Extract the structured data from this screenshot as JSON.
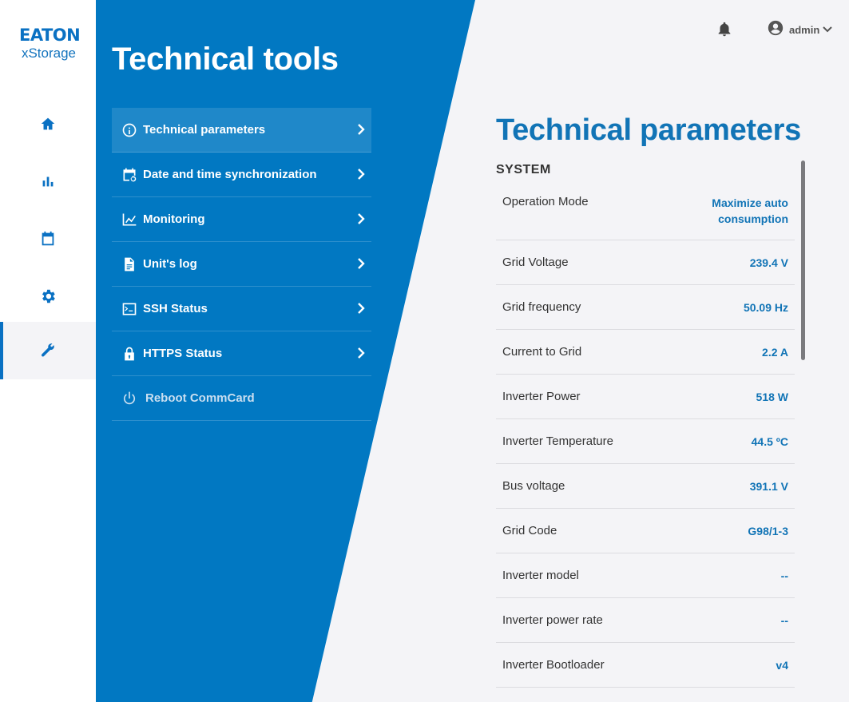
{
  "brand": {
    "name": "EATON",
    "product": "xStorage"
  },
  "rail": {
    "items": [
      {
        "icon": "home-icon"
      },
      {
        "icon": "bar-chart-icon"
      },
      {
        "icon": "calendar-icon"
      },
      {
        "icon": "gear-icon"
      },
      {
        "icon": "wrench-icon",
        "active": true
      }
    ]
  },
  "tools": {
    "title": "Technical tools",
    "menu": [
      {
        "label": "Technical parameters",
        "icon": "info-icon",
        "active": true
      },
      {
        "label": "Date and time synchronization",
        "icon": "calendar-sync-icon"
      },
      {
        "label": "Monitoring",
        "icon": "line-chart-icon"
      },
      {
        "label": "Unit's log",
        "icon": "document-icon"
      },
      {
        "label": "SSH Status",
        "icon": "terminal-icon"
      },
      {
        "label": "HTTPS Status",
        "icon": "lock-icon"
      },
      {
        "label": "Reboot CommCard",
        "icon": "power-icon"
      }
    ]
  },
  "header": {
    "user": "admin"
  },
  "main": {
    "title": "Technical parameters",
    "section": "SYSTEM",
    "rows": [
      {
        "key": "Operation Mode",
        "value": "Maximize auto consumption"
      },
      {
        "key": "Grid Voltage",
        "value": "239.4 V"
      },
      {
        "key": "Grid frequency",
        "value": "50.09 Hz"
      },
      {
        "key": "Current to Grid",
        "value": "2.2 A"
      },
      {
        "key": "Inverter Power",
        "value": "518 W"
      },
      {
        "key": "Inverter Temperature",
        "value": "44.5 ºC"
      },
      {
        "key": "Bus voltage",
        "value": "391.1 V"
      },
      {
        "key": "Grid Code",
        "value": "G98/1-3"
      },
      {
        "key": "Inverter model",
        "value": "--"
      },
      {
        "key": "Inverter power rate",
        "value": "--"
      },
      {
        "key": "Inverter Bootloader",
        "value": "v4"
      }
    ]
  },
  "colors": {
    "accent": "#0178c2",
    "value": "#1174b6",
    "background": "#f4f4f7"
  }
}
